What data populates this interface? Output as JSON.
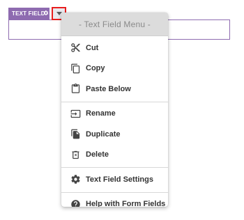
{
  "field": {
    "tag_label": "TEXT FIELD",
    "tag_icon": "gear-icon",
    "value": ""
  },
  "menu_toggle": {
    "icon": "caret-down-icon",
    "highlight_color": "#e81e1e"
  },
  "menu": {
    "header": "- Text Field Menu -",
    "groups": [
      [
        {
          "label": "Cut",
          "icon": "scissors-icon"
        },
        {
          "label": "Copy",
          "icon": "copy-icon"
        },
        {
          "label": "Paste Below",
          "icon": "clipboard-icon"
        }
      ],
      [
        {
          "label": "Rename",
          "icon": "rename-icon"
        },
        {
          "label": "Duplicate",
          "icon": "duplicate-icon"
        },
        {
          "label": "Delete",
          "icon": "trash-icon"
        }
      ],
      [
        {
          "label": "Text Field Settings",
          "icon": "gear-icon"
        }
      ],
      [
        {
          "label": "Help with Form Fields",
          "icon": "help-icon"
        }
      ]
    ]
  },
  "colors": {
    "accent": "#8e6bb0",
    "menu_header_bg": "#dcdcdc",
    "menu_header_text": "#8a8a8a",
    "text": "#333333"
  }
}
